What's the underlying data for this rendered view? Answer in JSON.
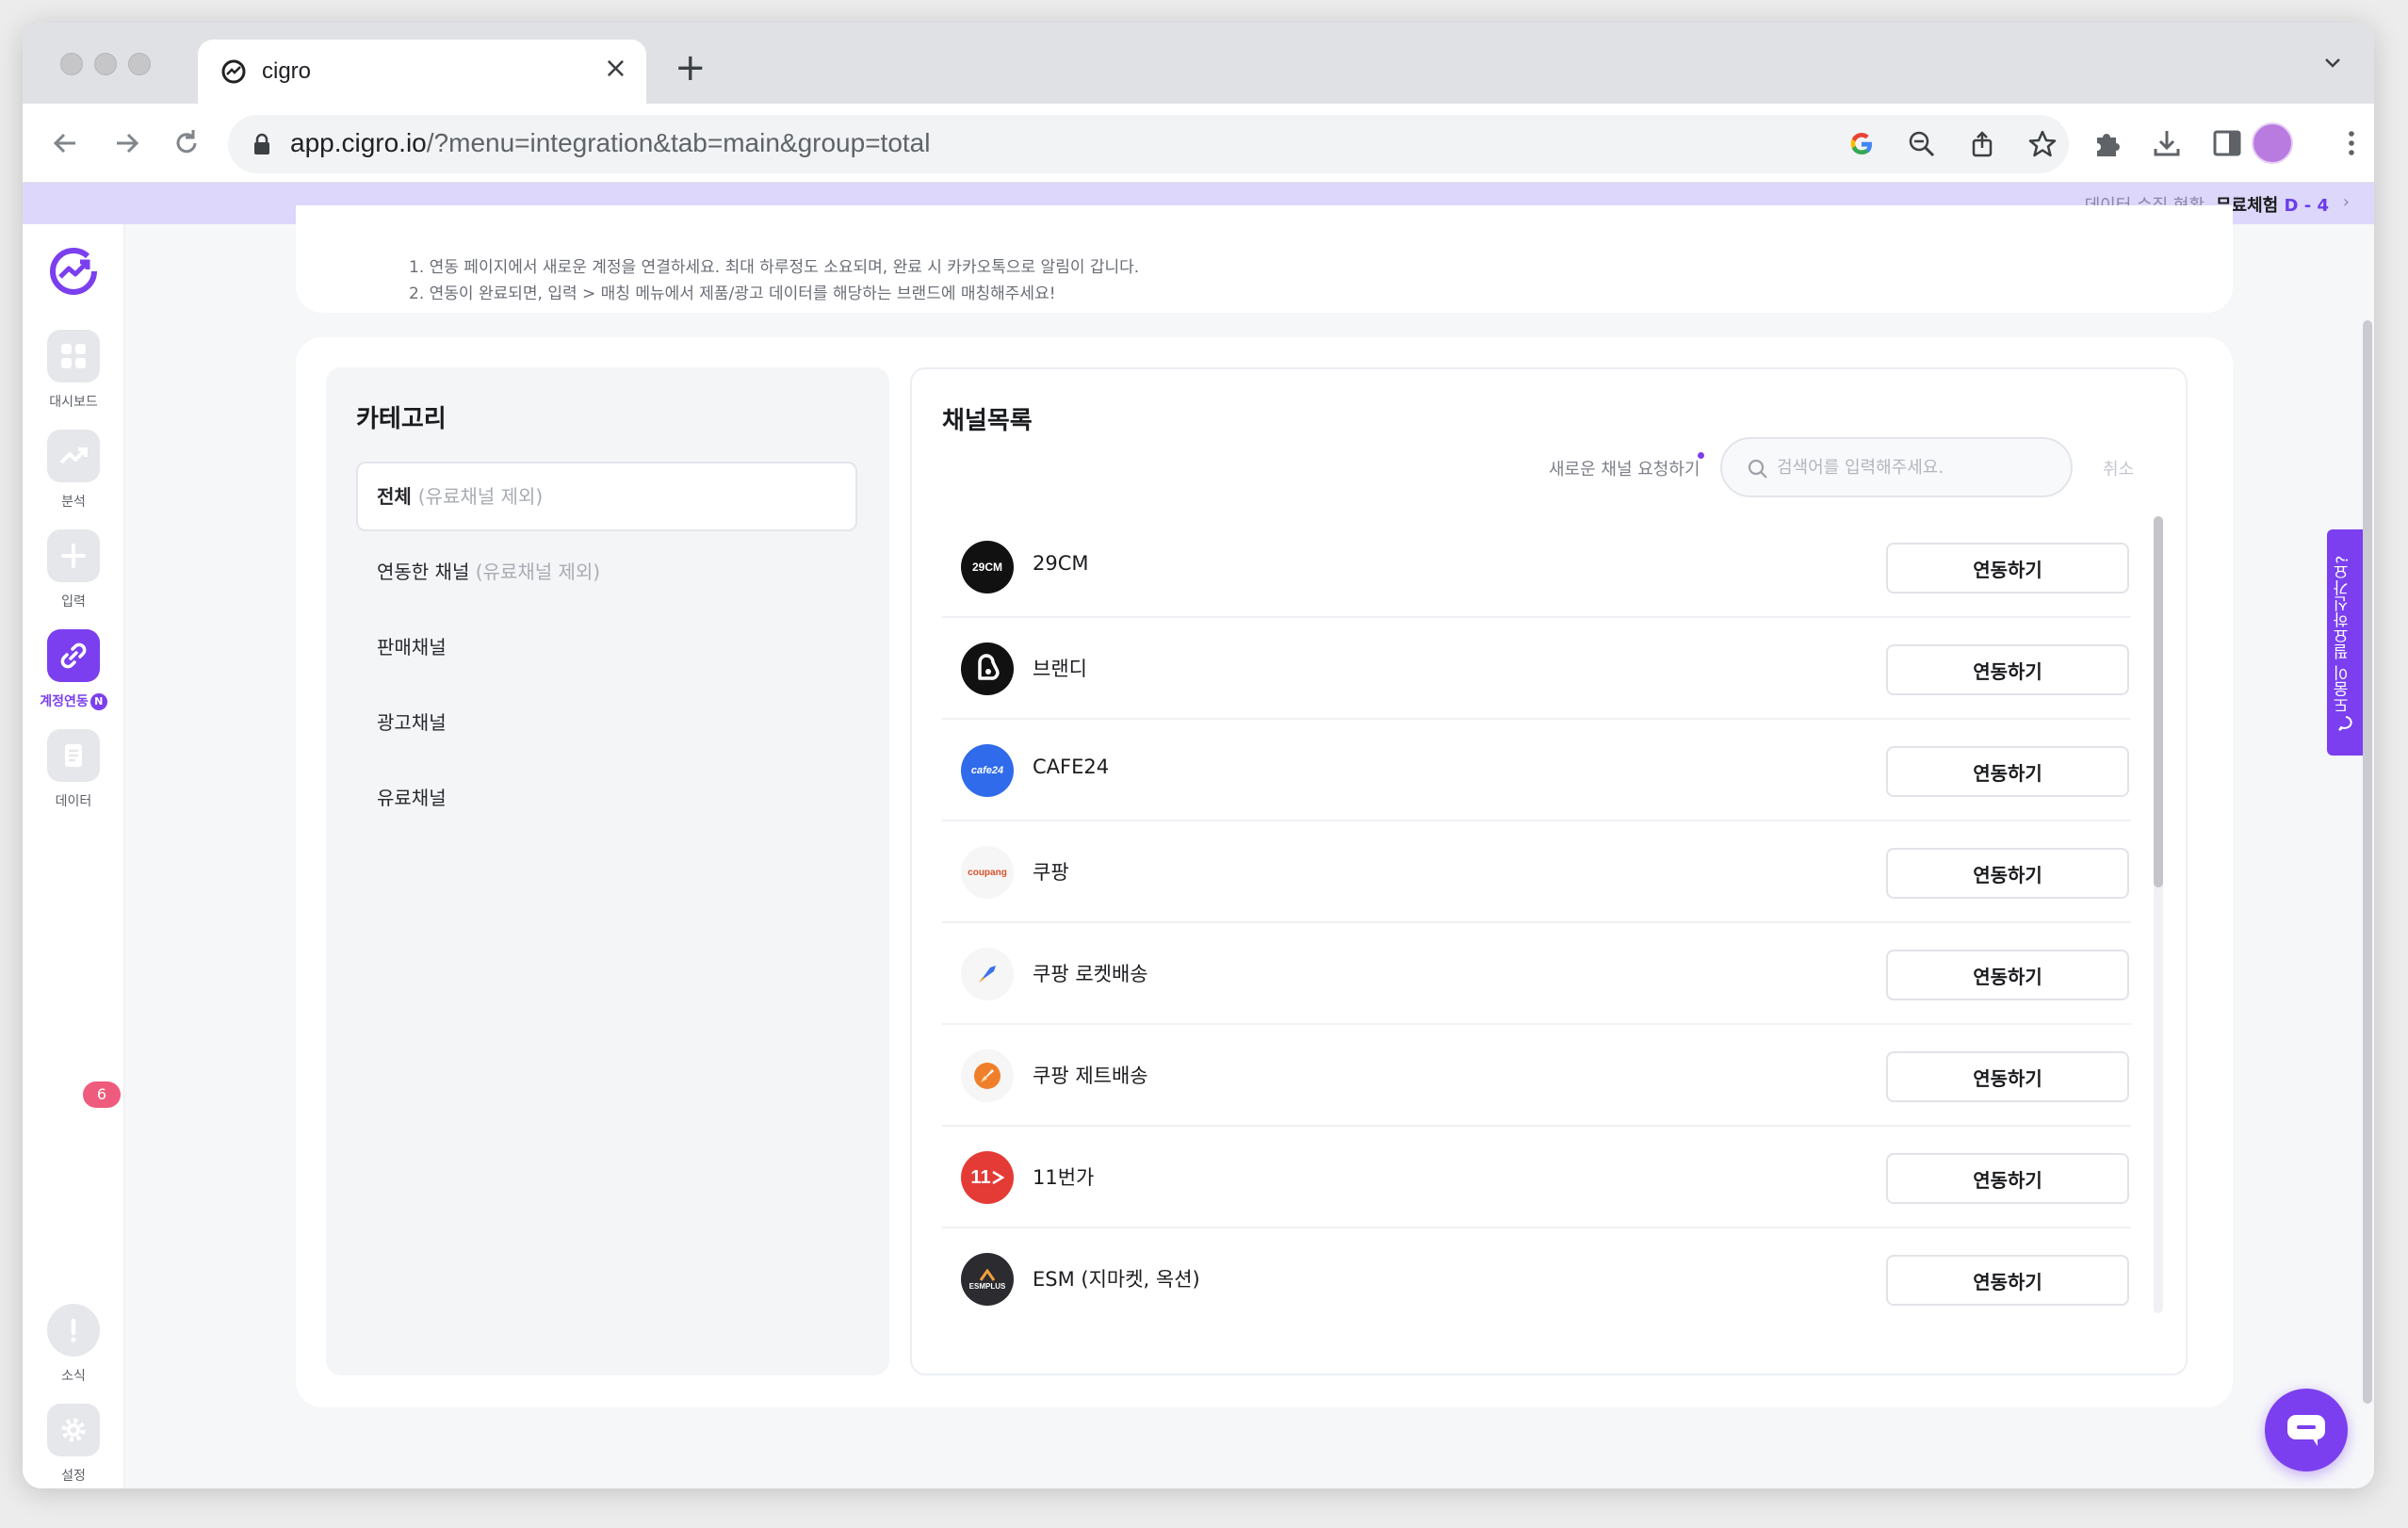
{
  "browser": {
    "tab_title": "cigro",
    "url_host": "app.cigro.io",
    "url_rest": "/?menu=integration&tab=main&group=total"
  },
  "promo": {
    "status_link": "데이터 수집 현황",
    "trial_label": "무료체험",
    "trial_days": "D - 4"
  },
  "nav": {
    "items": [
      {
        "label": "대시보드",
        "icon": "dashboard-icon"
      },
      {
        "label": "분석",
        "icon": "chart-icon"
      },
      {
        "label": "입력",
        "icon": "plus-icon"
      },
      {
        "label": "계정연동",
        "icon": "link-icon",
        "badge": "N"
      },
      {
        "label": "데이터",
        "icon": "data-icon"
      }
    ],
    "bottom": [
      {
        "label": "소식",
        "icon": "alert-icon",
        "badge": "6"
      },
      {
        "label": "설정",
        "icon": "gear-icon"
      }
    ]
  },
  "notes": [
    "1. 연동 페이지에서 새로운 계정을 연결하세요. 최대 하루정도 소요되며, 완료 시 카카오톡으로 알림이 갑니다.",
    "2. 연동이 완료되면, 입력 > 매칭 메뉴에서 제품/광고 데이터를 해당하는 브랜드에 매칭해주세요!"
  ],
  "category": {
    "title": "카테고리",
    "items": [
      {
        "label": "전체",
        "sub": "(유료채널 제외)"
      },
      {
        "label": "연동한 채널",
        "sub": "(유료채널 제외)"
      },
      {
        "label": "판매채널",
        "sub": ""
      },
      {
        "label": "광고채널",
        "sub": ""
      },
      {
        "label": "유료채널",
        "sub": ""
      }
    ]
  },
  "channels": {
    "title": "채널목록",
    "request_label": "새로운 채널 요청하기",
    "search_placeholder": "검색어를 입력해주세요.",
    "cancel_label": "취소",
    "connect_label": "연동하기",
    "items": [
      {
        "name": "29CM",
        "logo_text": "29CM",
        "logo_bg": "#111111",
        "logo_fg": "#ffffff"
      },
      {
        "name": "브랜디",
        "logo_text": "",
        "logo_bg": "#111111",
        "logo_fg": "#ffffff"
      },
      {
        "name": "CAFE24",
        "logo_text": "cafe24",
        "logo_bg": "#2f6bea",
        "logo_fg": "#ffffff"
      },
      {
        "name": "쿠팡",
        "logo_text": "coupang",
        "logo_bg": "#f6f6f6",
        "logo_fg": "#e24a2b"
      },
      {
        "name": "쿠팡 로켓배송",
        "logo_text": "",
        "logo_bg": "#f6f6f6",
        "logo_fg": "#3a72e8"
      },
      {
        "name": "쿠팡 제트배송",
        "logo_text": "",
        "logo_bg": "#f6f6f6",
        "logo_fg": "#f07f2b"
      },
      {
        "name": "11번가",
        "logo_text": "11",
        "logo_bg": "#e43b36",
        "logo_fg": "#ffffff"
      },
      {
        "name": "ESM (지마켓, 옥션)",
        "logo_text": "ESMPLUS",
        "logo_bg": "#2b2b30",
        "logo_fg": "#ffffff"
      }
    ]
  },
  "help_tab": "도움이 필요하신가요?",
  "colors": {
    "accent": "#7b3fef",
    "promo_bg": "#dcd7fb",
    "badge_red": "#ef5b7c"
  }
}
